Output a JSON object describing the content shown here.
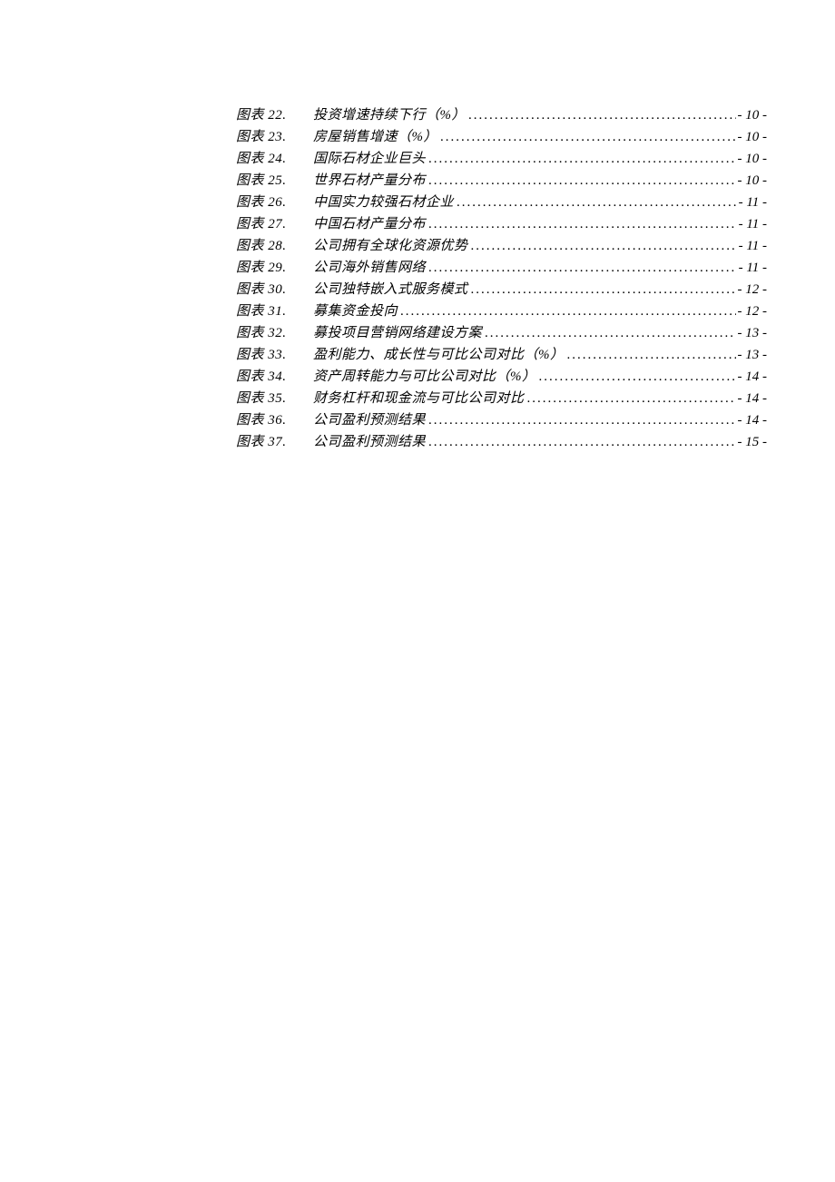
{
  "toc": [
    {
      "label": "图表 22.",
      "title": "投资增速持续下行（%）",
      "page": "- 10 -"
    },
    {
      "label": "图表 23.",
      "title": "房屋销售增速（%）",
      "page": "- 10 -"
    },
    {
      "label": "图表 24.",
      "title": "国际石材企业巨头",
      "page": "- 10 -"
    },
    {
      "label": "图表 25.",
      "title": "世界石材产量分布",
      "page": "- 10 -"
    },
    {
      "label": "图表 26.",
      "title": "中国实力较强石材企业",
      "page": "- 11 -"
    },
    {
      "label": "图表 27.",
      "title": "中国石材产量分布",
      "page": "- 11 -"
    },
    {
      "label": "图表 28.",
      "title": "公司拥有全球化资源优势",
      "page": "- 11 -"
    },
    {
      "label": "图表 29.",
      "title": "公司海外销售网络",
      "page": "- 11 -"
    },
    {
      "label": "图表 30.",
      "title": "公司独特嵌入式服务模式",
      "page": "- 12 -"
    },
    {
      "label": "图表 31.",
      "title": "募集资金投向",
      "page": "- 12 -"
    },
    {
      "label": "图表 32.",
      "title": "募投项目营销网络建设方案",
      "page": "- 13 -"
    },
    {
      "label": "图表 33.",
      "title": "盈利能力、成长性与可比公司对比（%）",
      "page": "- 13 -"
    },
    {
      "label": "图表 34.",
      "title": "资产周转能力与可比公司对比（%）",
      "page": "- 14 -"
    },
    {
      "label": "图表 35.",
      "title": "财务杠杆和现金流与可比公司对比",
      "page": "- 14 -"
    },
    {
      "label": "图表 36.",
      "title": "公司盈利预测结果",
      "page": "- 14 -"
    },
    {
      "label": "图表 37.",
      "title": "公司盈利预测结果",
      "page": "- 15 -"
    }
  ]
}
